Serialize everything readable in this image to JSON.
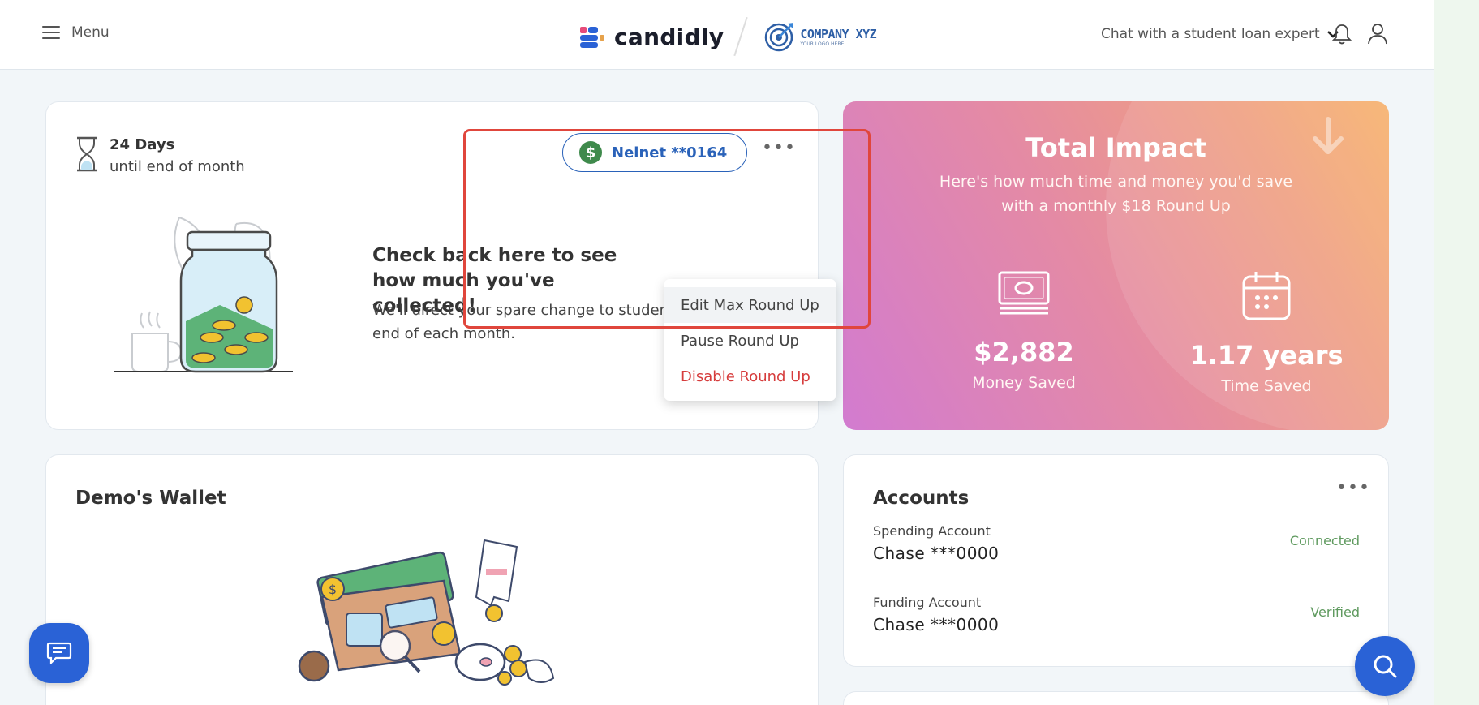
{
  "header": {
    "menu_label": "Menu",
    "brand_name": "candidly",
    "company_name": "COMPANY XYZ",
    "company_tagline": "YOUR LOGO HERE",
    "chat_expert": "Chat with a student loan expert",
    "icons": [
      "menu-icon",
      "chevron-down-icon",
      "bell-icon",
      "user-icon"
    ]
  },
  "roundup": {
    "days_count": "24 Days",
    "days_caption": "until end of month",
    "lender_chip": "Nelnet **0164",
    "lender_icon": "$",
    "more": "•••",
    "title": "Check back here to see how much you've collected!",
    "body": "We'll direct your spare change to student debt at the end of each month.",
    "menu": {
      "edit": "Edit Max Round Up",
      "pause": "Pause Round Up",
      "disable": "Disable Round Up"
    }
  },
  "impact": {
    "title": "Total Impact",
    "subtitle": "Here's how much time and money you'd save with a monthly $18 Round Up",
    "money_value": "$2,882",
    "money_label": "Money Saved",
    "time_value": "1.17 years",
    "time_label": "Time Saved"
  },
  "wallet": {
    "title": "Demo's Wallet"
  },
  "accounts": {
    "title": "Accounts",
    "more": "•••",
    "rows": [
      {
        "label": "Spending Account",
        "value": "Chase ***0000",
        "status": "Connected"
      },
      {
        "label": "Funding Account",
        "value": "Chase ***0000",
        "status": "Verified"
      }
    ]
  },
  "colors": {
    "accent_blue": "#2a62b9",
    "danger": "#d63c3c",
    "status_green": "#5f9a5f",
    "highlight_red": "#e0463c"
  }
}
